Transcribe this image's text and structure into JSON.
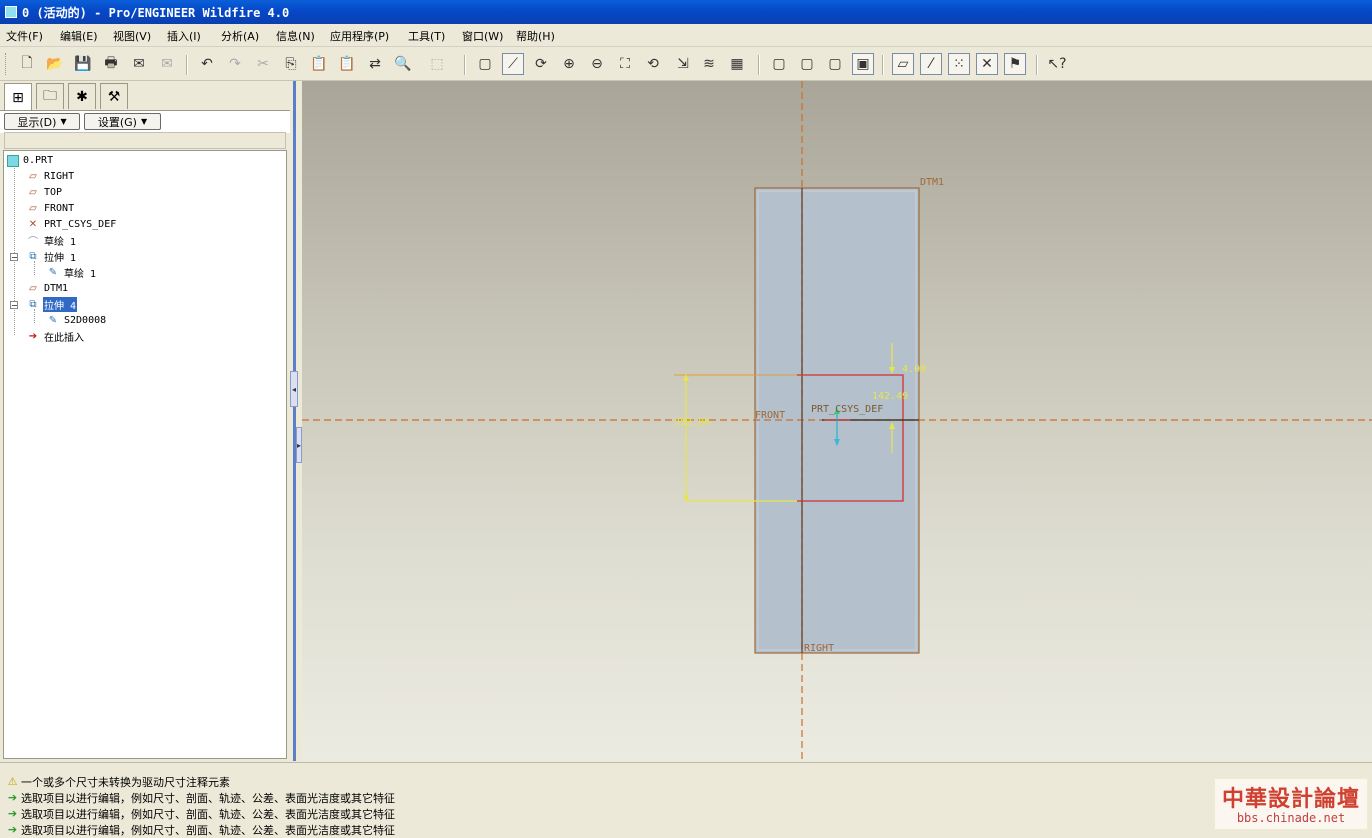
{
  "window": {
    "title": "0 (活动的) - Pro/ENGINEER Wildfire 4.0"
  },
  "menu": [
    "文件(F)",
    "编辑(E)",
    "视图(V)",
    "插入(I)",
    "分析(A)",
    "信息(N)",
    "应用程序(P)",
    "工具(T)",
    "窗口(W)",
    "帮助(H)"
  ],
  "toolbar": {
    "new": "🗋",
    "open": "📂",
    "save": "💾",
    "print": "🖶",
    "mail": "✉",
    "mail2": "✉",
    "undo": "↶",
    "redo": "↷",
    "cut": "✂",
    "copy": "⎘",
    "paste": "📋",
    "paste_special": "📋",
    "regen": "⇄",
    "find": "🔍",
    "select_box": "⬚",
    "repaint": "▢",
    "orient": "⟋",
    "spin": "⟳",
    "zoom_in": "⊕",
    "zoom_out": "⊖",
    "refit": "⛶",
    "reorient": "⟲",
    "saved_views": "⇲",
    "layers": "≋",
    "view_mgr": "▦",
    "wireframe": "▢",
    "hidden_line": "▢",
    "no_hidden": "▢",
    "shading": "▣",
    "datum_planes": "▱",
    "datum_axes": "⁄",
    "datum_points": "⁙",
    "csys": "✕",
    "annotations": "⚑",
    "context_help": "↖?"
  },
  "panel": {
    "tabs": [
      "model-tree",
      "folder-browser",
      "favorites",
      "connections"
    ],
    "show_label": "显示(D)",
    "settings_label": "设置(G)",
    "tree": [
      {
        "label": "0.PRT",
        "icon": "part-icon"
      },
      {
        "label": "RIGHT",
        "icon": "datum-plane-icon"
      },
      {
        "label": "TOP",
        "icon": "datum-plane-icon"
      },
      {
        "label": "FRONT",
        "icon": "datum-plane-icon"
      },
      {
        "label": "PRT_CSYS_DEF",
        "icon": "csys-icon"
      },
      {
        "label": "草绘 1",
        "icon": "sketch-icon"
      },
      {
        "label": "拉伸 1",
        "icon": "extrude-icon"
      },
      {
        "label": "草绘 1",
        "icon": "sketch-icon"
      },
      {
        "label": "DTM1",
        "icon": "datum-plane-icon"
      },
      {
        "label": "拉伸 4",
        "icon": "extrude-icon"
      },
      {
        "label": "S2D0008",
        "icon": "sketch-icon"
      },
      {
        "label": "在此插入",
        "icon": "insert-arrow-icon"
      }
    ]
  },
  "graphics": {
    "datum_labels": {
      "dtm1": "DTM1",
      "front": "FRONT",
      "right": "RIGHT",
      "csys": "PRT_CSYS_DEF"
    },
    "dimensions": {
      "height": "353.86",
      "width": "142.49",
      "small": "4.00"
    }
  },
  "messages": [
    {
      "icon": "warning-icon",
      "text": "一个或多个尺寸未转换为驱动尺寸注释元素"
    },
    {
      "icon": "prompt-arrow-icon",
      "text": "选取项目以进行编辑，例如尺寸、剖面、轨迹、公差、表面光洁度或其它特征"
    },
    {
      "icon": "prompt-arrow-icon",
      "text": "选取项目以进行编辑，例如尺寸、剖面、轨迹、公差、表面光洁度或其它特征"
    },
    {
      "icon": "prompt-arrow-icon",
      "text": "选取项目以进行编辑，例如尺寸、剖面、轨迹、公差、表面光洁度或其它特征"
    }
  ],
  "watermark": {
    "title": "中華設計論壇",
    "url": "bbs.chinade.net"
  },
  "colors": {
    "datum": "#c8702a",
    "dim": "#e6e64a",
    "sketch": "#d23030",
    "part_face": "#b4c0cc",
    "title_bar": "#0548c8"
  }
}
